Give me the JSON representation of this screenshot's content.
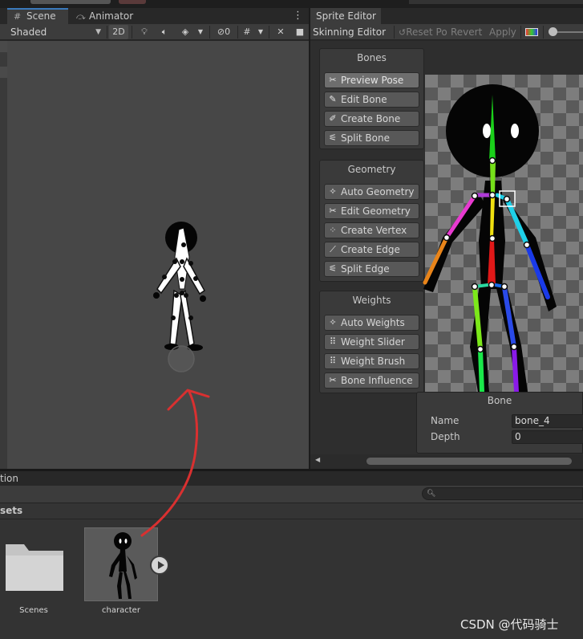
{
  "scene_panel": {
    "tabs": [
      {
        "label": "Scene",
        "icon": "grid-icon"
      },
      {
        "label": "Animator",
        "icon": "animator-icon"
      }
    ],
    "toolbar": {
      "shading_mode": "Shaded",
      "mode_2d": "2D",
      "hidden_count": "0"
    }
  },
  "sprite_editor": {
    "tab": "Sprite Editor",
    "toolbar": {
      "mode_dropdown": "Skinning Editor",
      "reset_pose": "Reset Po",
      "revert": "Revert",
      "apply": "Apply"
    },
    "groups": [
      {
        "title": "Bones",
        "buttons": [
          {
            "label": "Preview Pose",
            "icon": "preview-pose-icon",
            "active": true
          },
          {
            "label": "Edit Bone",
            "icon": "edit-bone-icon"
          },
          {
            "label": "Create Bone",
            "icon": "create-bone-icon"
          },
          {
            "label": "Split Bone",
            "icon": "split-bone-icon"
          }
        ]
      },
      {
        "title": "Geometry",
        "buttons": [
          {
            "label": "Auto Geometry",
            "icon": "auto-geometry-icon"
          },
          {
            "label": "Edit Geometry",
            "icon": "edit-geometry-icon"
          },
          {
            "label": "Create Vertex",
            "icon": "create-vertex-icon"
          },
          {
            "label": "Create Edge",
            "icon": "create-edge-icon"
          },
          {
            "label": "Split Edge",
            "icon": "split-edge-icon"
          }
        ]
      },
      {
        "title": "Weights",
        "buttons": [
          {
            "label": "Auto Weights",
            "icon": "auto-weights-icon"
          },
          {
            "label": "Weight Slider",
            "icon": "weight-slider-icon"
          },
          {
            "label": "Weight Brush",
            "icon": "weight-brush-icon"
          },
          {
            "label": "Bone Influence",
            "icon": "bone-influence-icon"
          }
        ]
      }
    ],
    "bone_inspector": {
      "title": "Bone",
      "name_label": "Name",
      "name_value": "bone_4",
      "depth_label": "Depth",
      "depth_value": "0"
    }
  },
  "project_panel": {
    "tab_label": "tion",
    "breadcrumb": "sets",
    "assets": [
      {
        "name": "Scenes",
        "type": "folder"
      },
      {
        "name": "character",
        "type": "prefab"
      }
    ]
  },
  "watermark": "CSDN @代码骑士",
  "colors": {
    "tab_accent": "#3a79bb",
    "annotation_arrow": "#d93030",
    "selected_bone": "#1fd0e8"
  }
}
